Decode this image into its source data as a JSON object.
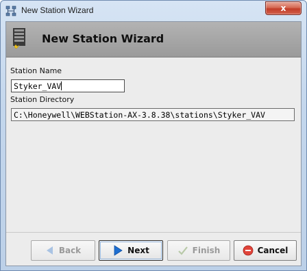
{
  "window": {
    "title": "New Station Wizard",
    "close_label": "x"
  },
  "header": {
    "title": "New Station Wizard",
    "icon": "station-database-icon"
  },
  "form": {
    "station_name_label": "Station Name",
    "station_name_value": "Styker_VAV",
    "station_directory_label": "Station Directory",
    "station_directory_value": "C:\\Honeywell\\WEBStation-AX-3.8.38\\stations\\Styker_VAV"
  },
  "buttons": {
    "back": {
      "label": "Back",
      "icon": "left-arrow-icon",
      "enabled": false
    },
    "next": {
      "label": "Next",
      "icon": "right-arrow-icon",
      "enabled": true
    },
    "finish": {
      "label": "Finish",
      "icon": "checkmark-icon",
      "enabled": false
    },
    "cancel": {
      "label": "Cancel",
      "icon": "cancel-circle-icon",
      "enabled": true
    }
  },
  "colors": {
    "header_bg": "#a6a6a6",
    "next_arrow": "#1f6fd1",
    "cancel_icon": "#e0443a",
    "close_button": "#c8452f"
  }
}
